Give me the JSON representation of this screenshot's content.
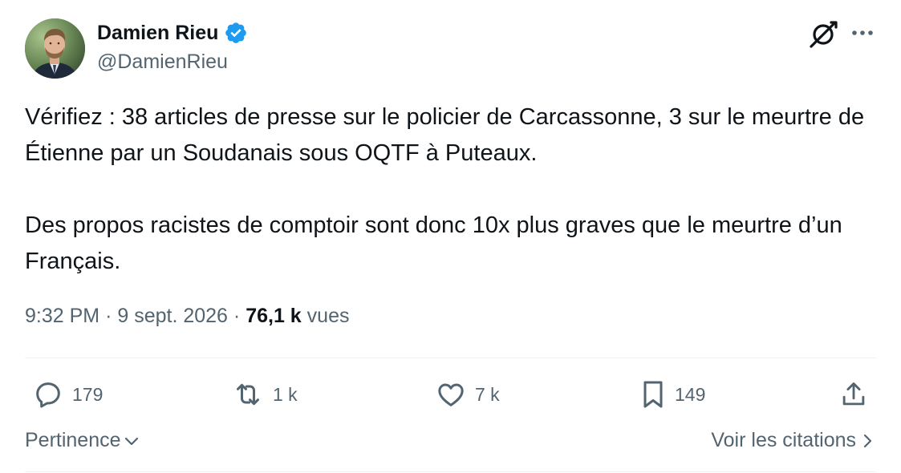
{
  "author": {
    "name": "Damien Rieu",
    "handle": "@DamienRieu",
    "verified": true
  },
  "tweet": {
    "paragraphs": [
      "Vérifiez : 38 articles de presse sur le policier de Carcassonne, 3 sur le meurtre de Étienne par un Soudanais sous OQTF à Puteaux.",
      "Des propos racistes de comptoir sont donc 10x plus graves que le meurtre d’un Français."
    ]
  },
  "meta": {
    "time": "9:32 PM",
    "separator": "·",
    "date": "9 sept. 2026",
    "views_count": "76,1 k",
    "views_label": "vues"
  },
  "actions": {
    "reply_count": "179",
    "retweet_count": "1 k",
    "like_count": "7 k",
    "bookmark_count": "149"
  },
  "footer": {
    "sort_label": "Pertinence",
    "quotes_label": "Voir les citations"
  },
  "colors": {
    "text": "#0f1419",
    "secondary": "#536471",
    "verified": "#1d9bf0",
    "divider": "#eff3f4"
  }
}
